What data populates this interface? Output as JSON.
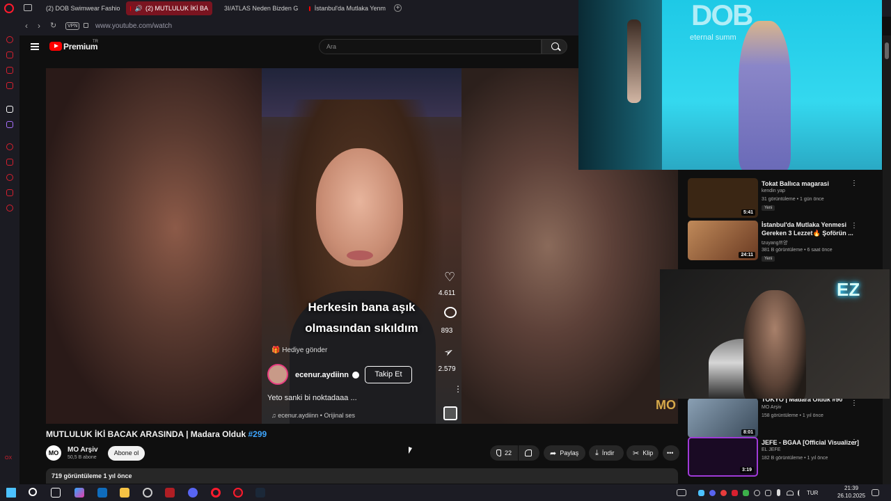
{
  "browser": {
    "tabs": [
      {
        "label": "(2) DOB Swimwear Fashio"
      },
      {
        "label": "(2) MUTLULUK İKİ BA"
      },
      {
        "label": "3I/ATLAS Neden Bizden G"
      },
      {
        "label": "İstanbul'da Mutlaka Yenm"
      }
    ],
    "add_tab": "+",
    "url": "www.youtube.com/watch",
    "vpn_label": "VPN",
    "sidebar_label": "OX"
  },
  "youtube": {
    "brand": "Premium",
    "brand_sup": "TR",
    "search_placeholder": "Ara"
  },
  "video": {
    "overlay_line1": "Herkesin bana aşık",
    "overlay_line2": "olmasından sıkıldım",
    "likes": "4.611",
    "comments": "893",
    "shares": "2.579",
    "gift_label": "Hediye gönder",
    "tiktok_user": "ecenur.aydiinn",
    "follow_label": "Takip Et",
    "caption": "Yeto sanki bi noktadaaa ...",
    "music": "ecenur.aydiinn • Orijinal ses",
    "watermark": "MO",
    "title": "MUTLULUK İKİ BACAK ARASINDA | Madara Olduk",
    "hashtag": "#299",
    "channel_initials": "MO",
    "channel_name": "MO Arşiv",
    "channel_subs": "50,5 B abone",
    "subscribe_label": "Abone ol",
    "like_count": "22",
    "share_label": "Paylaş",
    "download_label": "İndir",
    "clip_label": "Klip",
    "more_label": "•••",
    "description": "719 görüntüleme  1 yıl önce"
  },
  "recommendations": [
    {
      "title": "Tokat Ballıca magarasi",
      "channel": "kendin yap",
      "meta": "31 görüntüleme • 1 gün önce",
      "duration": "5:41",
      "badge": "Yeni",
      "thumb_color": "#3a2614"
    },
    {
      "title": "İstanbul'da Mutlaka Yenmesi Gereken 3 Lezzet🔥 Şoförün ...",
      "channel": "tzuyang쯔양",
      "meta": "381 B görüntüleme • 6 saat önce",
      "duration": "24:11",
      "badge": "Yeni",
      "thumb_color": "#8a5a3a"
    },
    {
      "title": "TOKYO | Madara Olduk #90",
      "channel": "MO Arşiv",
      "meta": "158 görüntüleme • 1 yıl önce",
      "duration": "8:01",
      "badge": "",
      "thumb_color": "#6a7a8a"
    },
    {
      "title": "JEFE - BGAA [Official Visualizer]",
      "channel": "EL JEFE",
      "meta": "182 B görüntüleme • 1 yıl önce",
      "duration": "3:19",
      "badge": "",
      "thumb_color": "#6a2a8a"
    }
  ],
  "fashion_overlay": {
    "logo": "DOB",
    "sub": "eternal summ"
  },
  "webcam_overlay": {
    "sign": "EZ"
  },
  "taskbar": {
    "language": "TUR",
    "time": "21:39",
    "date": "26.10.2025"
  }
}
